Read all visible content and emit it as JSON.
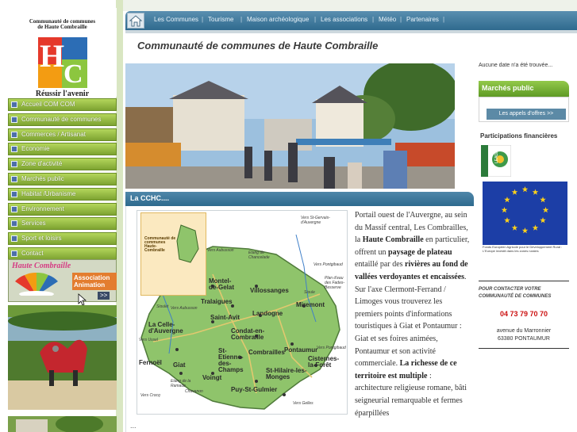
{
  "logo": {
    "top_line1": "Communauté de communes",
    "top_line2": "de Haute Combraille",
    "letter_h": "H",
    "letter_c": "C",
    "slogan": "Réussir l'avenir",
    "colors": [
      "#e5392b",
      "#2c6db5",
      "#8cc63f",
      "#f39c12"
    ]
  },
  "menu": [
    {
      "label": "Accueil COM COM"
    },
    {
      "label": "Communauté de communes"
    },
    {
      "label": "Commerces / Artisanat"
    },
    {
      "label": "Economie"
    },
    {
      "label": "Zone d'activité"
    },
    {
      "label": "Marchés public"
    },
    {
      "label": "Habitat /Urbanisme"
    },
    {
      "label": "Environnement"
    },
    {
      "label": "Services"
    },
    {
      "label": "Sport et loisirs"
    },
    {
      "label": "Contact"
    }
  ],
  "asso_banner": {
    "title": "Haute Combraille",
    "label": "Association Animation",
    "more": ">>"
  },
  "topnav": {
    "home_icon": "home-icon",
    "items": [
      "Les Communes",
      "Tourisme",
      "Maison archéologique",
      "Les associations",
      "Météo",
      "Partenaires"
    ]
  },
  "main": {
    "title": "Communauté de communes de Haute Combraille",
    "section_title": "La CCHC....",
    "ellipsis": "...",
    "desc_parts": [
      {
        "t": "Portail ouest de l'Auvergne, au sein du Massif central, Les Combrailles, la ",
        "b": false
      },
      {
        "t": "Haute Combraille",
        "b": true
      },
      {
        "t": " en particulier, offrent un ",
        "b": false
      },
      {
        "t": "paysage de plateau",
        "b": true
      },
      {
        "t": " entaillé par des ",
        "b": false
      },
      {
        "t": "rivières au fond de vallées verdoyantes et encaissées",
        "b": true
      },
      {
        "t": ". Sur l'axe Clermont-Ferrand / Limoges vous trouverez les premiers points d'informations touristiques à Giat et Pontaumur : Giat et ses foires animées, Pontaumur et son activité commerciale.",
        "b": false
      },
      {
        "t": " La richesse de ce territoire est multiple",
        "b": true
      },
      {
        "t": " : architecture religieuse romane, bâti seigneurial remarquable et fermes éparpillées",
        "b": false
      }
    ]
  },
  "map": {
    "inset_label": "Communauté de communes Haute-Combraille",
    "places": [
      "Montel-de-Gelat",
      "Villossanges",
      "Miremont",
      "Tralaigues",
      "Saint-Avit",
      "Landogne",
      "La Celle-d'Auvergne",
      "Pontaumur",
      "Condat-en-Combraille",
      "Combrailles",
      "St-Etienne-des-Champs",
      "Cisternes-la-Forêt",
      "Fernoël",
      "Giat",
      "Voingt",
      "St-Hilaire-les-Monges",
      "Puy-St-Gulmier"
    ],
    "small_labels": [
      "Vers St-Gervais-d'Auvergne",
      "Etang de Chancelade",
      "Vers Aubusson",
      "Vers Pontgibaud",
      "Plan d'eau des Fades-Besserve",
      "Vers Ussel",
      "Vers Aubusson",
      "Vers Gelles",
      "Vers Pontgibaud",
      "Vers Crocq",
      "Etang de la Ramade",
      "Sioule",
      "Sioulet",
      "Chavanon"
    ]
  },
  "right": {
    "no_date": "Aucune date n'a été trouvée...",
    "marches_title": "Marchés public",
    "appels_button": "Les appels d'offres >>",
    "participations": "Participations financières",
    "leader_label": "LEADER",
    "eu_caption": "Fonds Européen Agricole pour le Développement Rural : L'Europe investit dans les zones rurales",
    "contact_title": "POUR CONTACTER VOTRE COMMUNAUTÉ DE COMMUNES",
    "phone": "04 73 79 70 70",
    "address1": "avenue du Marronnier",
    "address2": "63380 PONTAUMUR"
  }
}
